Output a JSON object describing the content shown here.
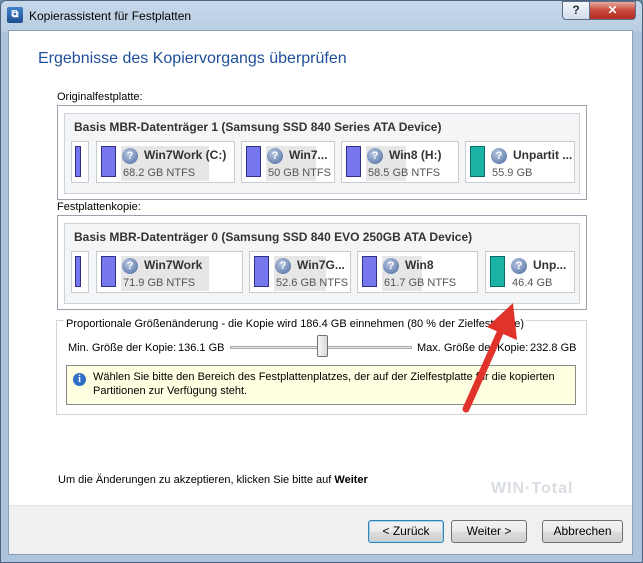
{
  "window": {
    "title": "Kopierassistent für Festplatten",
    "help_label": "?",
    "close_label": "✕",
    "app_icon": "disk-copy-icon"
  },
  "heading": "Ergebnisse des Kopiervorgangs überprüfen",
  "original": {
    "section_label": "Originalfestplatte:",
    "disk_title": "Basis MBR-Datenträger 1 (Samsung SSD 840 Series ATA Device)",
    "partitions": [
      {
        "name": "Win7Work (C:)",
        "size": "68.2 GB NTFS",
        "color": "#7878ee"
      },
      {
        "name": "Win7...",
        "size": "50 GB NTFS",
        "color": "#7878ee"
      },
      {
        "name": "Win8 (H:)",
        "size": "58.5 GB NTFS",
        "color": "#7878ee"
      },
      {
        "name": "Unpartit ...",
        "size": "55.9 GB",
        "color": "#1bb3a6"
      }
    ]
  },
  "copy": {
    "section_label": "Festplattenkopie:",
    "disk_title": "Basis MBR-Datenträger 0 (Samsung SSD 840 EVO 250GB ATA Device)",
    "partitions": [
      {
        "name": "Win7Work",
        "size": "71.9 GB NTFS",
        "color": "#7878ee"
      },
      {
        "name": "Win7G...",
        "size": "52.6 GB NTFS",
        "color": "#7878ee"
      },
      {
        "name": "Win8",
        "size": "61.7 GB NTFS",
        "color": "#7878ee"
      },
      {
        "name": "Unp...",
        "size": "46.4 GB",
        "color": "#1bb3a6"
      }
    ]
  },
  "resize": {
    "label": "Proportionale Größenänderung - die Kopie wird 186.4 GB einnehmen (80 % der Zielfestplatte)",
    "min_label": "Min. Größe der Kopie:",
    "min_value": "136.1 GB",
    "max_label": "Max. Größe der Kopie:",
    "max_value": "232.8 GB",
    "slider_fraction": 0.55
  },
  "info": {
    "icon": "info-icon",
    "text": "Wählen Sie bitte den Bereich des Festplattenplatzes, der auf der Zielfestplatte für die kopierten Partitionen zur Verfügung steht."
  },
  "footer": {
    "text_prefix": "Um die Änderungen zu akzeptieren, klicken Sie bitte auf",
    "text_bold": "Weiter"
  },
  "buttons": {
    "back": "< Zurück",
    "next": "Weiter >",
    "cancel": "Abbrechen"
  },
  "watermark": "WIN Total",
  "colors": {
    "accent": "#1f4f9a",
    "annotation_arrow": "#e0332b"
  }
}
